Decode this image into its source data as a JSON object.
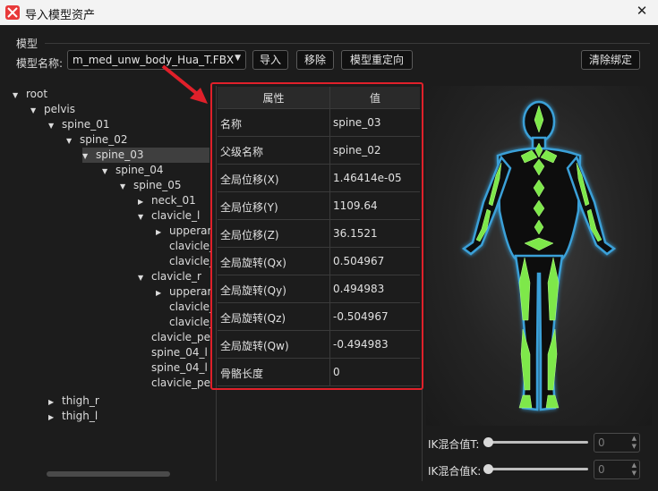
{
  "window": {
    "title": "导入模型资产"
  },
  "model_group": {
    "label": "模型",
    "name_label": "模型名称:",
    "selected_model": "m_med_unw_body_Hua_T.FBX"
  },
  "buttons": {
    "import": "导入",
    "remove": "移除",
    "retarget": "模型重定向",
    "clear_binding": "清除绑定"
  },
  "tree": {
    "items": [
      {
        "label": "root",
        "expander": "expanded"
      },
      {
        "label": "pelvis",
        "expander": "expanded"
      },
      {
        "label": "spine_01",
        "expander": "expanded"
      },
      {
        "label": "spine_02",
        "expander": "expanded"
      },
      {
        "label": "spine_03",
        "expander": "expanded",
        "selected": true
      },
      {
        "label": "spine_04",
        "expander": "expanded"
      },
      {
        "label": "spine_05",
        "expander": "expanded"
      },
      {
        "label": "neck_01",
        "expander": "collapsed"
      },
      {
        "label": "clavicle_l",
        "expander": "expanded"
      },
      {
        "label": "upperarm",
        "expander": "collapsed"
      },
      {
        "label": "clavicle_",
        "expander": "none"
      },
      {
        "label": "clavicle_",
        "expander": "none"
      },
      {
        "label": "clavicle_r",
        "expander": "expanded"
      },
      {
        "label": "upperarm",
        "expander": "collapsed"
      },
      {
        "label": "clavicle_",
        "expander": "none"
      },
      {
        "label": "clavicle_",
        "expander": "none"
      },
      {
        "label": "clavicle_pe",
        "expander": "none"
      },
      {
        "label": "spine_04_l",
        "expander": "none"
      },
      {
        "label": "spine_04_l",
        "expander": "none"
      },
      {
        "label": "clavicle_pe",
        "expander": "none"
      },
      {
        "label": "thigh_r",
        "expander": "collapsed"
      },
      {
        "label": "thigh_l",
        "expander": "collapsed"
      }
    ]
  },
  "properties": {
    "header_key": "属性",
    "header_value": "值",
    "rows": [
      {
        "key": "名称",
        "value": "spine_03"
      },
      {
        "key": "父级名称",
        "value": "spine_02"
      },
      {
        "key": "全局位移(X)",
        "value": "1.46414e-05"
      },
      {
        "key": "全局位移(Y)",
        "value": "1109.64"
      },
      {
        "key": "全局位移(Z)",
        "value": "36.1521"
      },
      {
        "key": "全局旋转(Qx)",
        "value": "0.504967"
      },
      {
        "key": "全局旋转(Qy)",
        "value": "0.494983"
      },
      {
        "key": "全局旋转(Qz)",
        "value": "-0.504967"
      },
      {
        "key": "全局旋转(Qw)",
        "value": "-0.494983"
      },
      {
        "key": "骨骼长度",
        "value": "0"
      }
    ]
  },
  "ik": {
    "t_label": "IK混合值T:",
    "t_value": "0",
    "k_label": "IK混合值K:",
    "k_value": "0"
  },
  "colors": {
    "highlight_box": "#e0202a",
    "bone": "#7ee84a",
    "body_glow": "#3aa0d8"
  }
}
